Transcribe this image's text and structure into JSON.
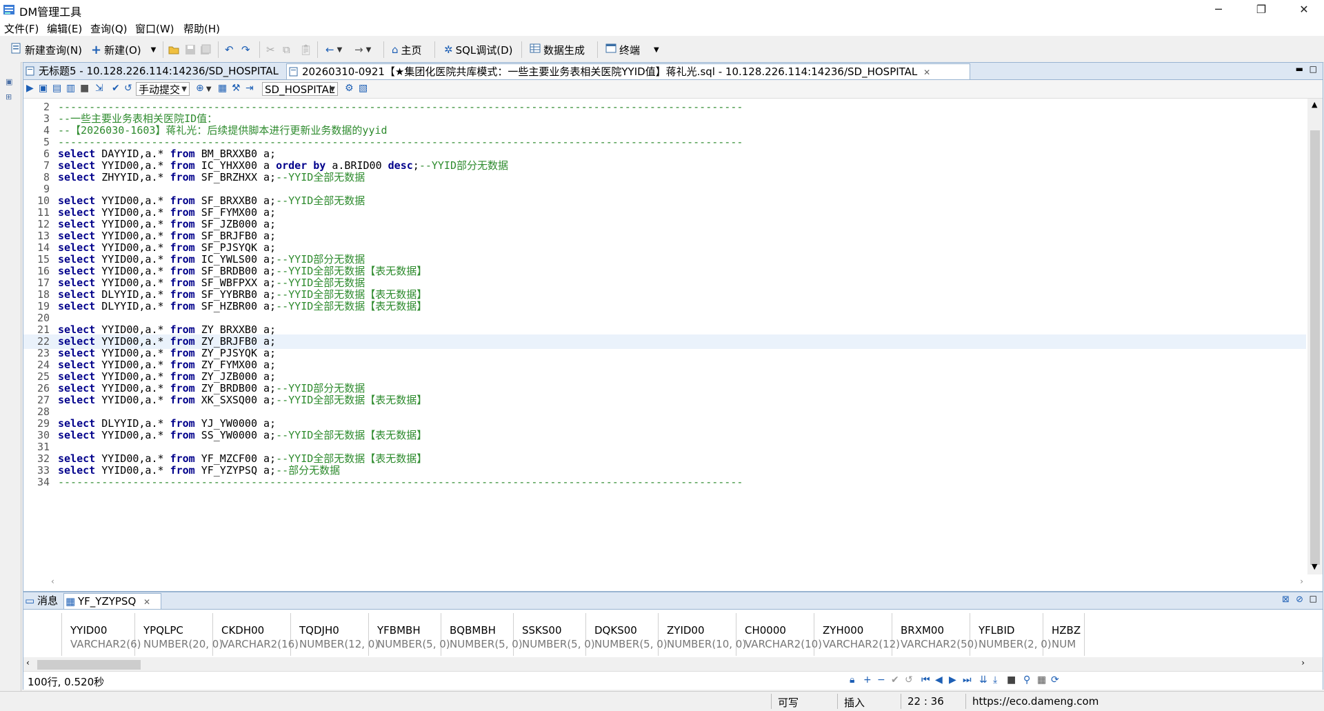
{
  "window": {
    "title": "DM管理工具",
    "minimize": "─",
    "maximize": "❐",
    "close": "✕"
  },
  "menu": [
    "文件(F)",
    "编辑(E)",
    "查询(Q)",
    "窗口(W)",
    "帮助(H)"
  ],
  "toolbar": {
    "new_query": "新建查询(N)",
    "new": "新建(O)",
    "home": "主页",
    "sql_debug": "SQL调试(D)",
    "data_gen": "数据生成",
    "terminal": "终端"
  },
  "tabs": [
    {
      "label": "无标题5 - 10.128.226.114:14236/SD_HOSPITAL"
    },
    {
      "label": "20260310-0921【★集团化医院共库模式：一些主要业务表相关医院YYID值】蒋礼光.sql - 10.128.226.114:14236/SD_HOSPITAL"
    }
  ],
  "editor_toolbar": {
    "commit_mode": "手动提交",
    "schema": "SD_HOSPITAL"
  },
  "code_lines": [
    {
      "n": "2",
      "parts": [
        [
          "cm",
          "--------------------------------------------------------------------------------------------------------------"
        ]
      ]
    },
    {
      "n": "3",
      "parts": [
        [
          "cm",
          "--一些主要业务表相关医院ID值："
        ]
      ]
    },
    {
      "n": "4",
      "parts": [
        [
          "cm",
          "--【2026030-1603】蒋礼光：后续提供脚本进行更新业务数据的yyid"
        ]
      ]
    },
    {
      "n": "5",
      "parts": [
        [
          "cm",
          "--------------------------------------------------------------------------------------------------------------"
        ]
      ]
    },
    {
      "n": "6",
      "parts": [
        [
          "kw",
          "select"
        ],
        [
          "pl",
          " DAYYID,a.* "
        ],
        [
          "kw",
          "from"
        ],
        [
          "pl",
          " BM_BRXXB0 a;"
        ]
      ]
    },
    {
      "n": "7",
      "parts": [
        [
          "kw",
          "select"
        ],
        [
          "pl",
          " YYID00,a.* "
        ],
        [
          "kw",
          "from"
        ],
        [
          "pl",
          " IC_YHXX00 a "
        ],
        [
          "kw",
          "order by"
        ],
        [
          "pl",
          " a.BRID00 "
        ],
        [
          "kw",
          "desc"
        ],
        [
          "pl",
          ";"
        ],
        [
          "cm",
          "--YYID部分无数据"
        ]
      ]
    },
    {
      "n": "8",
      "parts": [
        [
          "kw",
          "select"
        ],
        [
          "pl",
          " ZHYYID,a.* "
        ],
        [
          "kw",
          "from"
        ],
        [
          "pl",
          " SF_BRZHXX a;"
        ],
        [
          "cm",
          "--YYID全部无数据"
        ]
      ]
    },
    {
      "n": "9",
      "parts": []
    },
    {
      "n": "10",
      "parts": [
        [
          "kw",
          "select"
        ],
        [
          "pl",
          " YYID00,a.* "
        ],
        [
          "kw",
          "from"
        ],
        [
          "pl",
          " SF_BRXXB0 a;"
        ],
        [
          "cm",
          "--YYID全部无数据"
        ]
      ]
    },
    {
      "n": "11",
      "parts": [
        [
          "kw",
          "select"
        ],
        [
          "pl",
          " YYID00,a.* "
        ],
        [
          "kw",
          "from"
        ],
        [
          "pl",
          " SF_FYMX00 a;"
        ]
      ]
    },
    {
      "n": "12",
      "parts": [
        [
          "kw",
          "select"
        ],
        [
          "pl",
          " YYID00,a.* "
        ],
        [
          "kw",
          "from"
        ],
        [
          "pl",
          " SF_JZB000 a;"
        ]
      ]
    },
    {
      "n": "13",
      "parts": [
        [
          "kw",
          "select"
        ],
        [
          "pl",
          " YYID00,a.* "
        ],
        [
          "kw",
          "from"
        ],
        [
          "pl",
          " SF_BRJFB0 a;"
        ]
      ]
    },
    {
      "n": "14",
      "parts": [
        [
          "kw",
          "select"
        ],
        [
          "pl",
          " YYID00,a.* "
        ],
        [
          "kw",
          "from"
        ],
        [
          "pl",
          " SF_PJSYQK a;"
        ]
      ]
    },
    {
      "n": "15",
      "parts": [
        [
          "kw",
          "select"
        ],
        [
          "pl",
          " YYID00,a.* "
        ],
        [
          "kw",
          "from"
        ],
        [
          "pl",
          " IC_YWLS00 a;"
        ],
        [
          "cm",
          "--YYID部分无数据"
        ]
      ]
    },
    {
      "n": "16",
      "parts": [
        [
          "kw",
          "select"
        ],
        [
          "pl",
          " YYID00,a.* "
        ],
        [
          "kw",
          "from"
        ],
        [
          "pl",
          " SF_BRDB00 a;"
        ],
        [
          "cm",
          "--YYID全部无数据【表无数据】"
        ]
      ]
    },
    {
      "n": "17",
      "parts": [
        [
          "kw",
          "select"
        ],
        [
          "pl",
          " YYID00,a.* "
        ],
        [
          "kw",
          "from"
        ],
        [
          "pl",
          " SF_WBFPXX a;"
        ],
        [
          "cm",
          "--YYID全部无数据"
        ]
      ]
    },
    {
      "n": "18",
      "parts": [
        [
          "kw",
          "select"
        ],
        [
          "pl",
          " DLYYID,a.* "
        ],
        [
          "kw",
          "from"
        ],
        [
          "pl",
          " SF_YYBRB0 a;"
        ],
        [
          "cm",
          "--YYID全部无数据【表无数据】"
        ]
      ]
    },
    {
      "n": "19",
      "parts": [
        [
          "kw",
          "select"
        ],
        [
          "pl",
          " DLYYID,a.* "
        ],
        [
          "kw",
          "from"
        ],
        [
          "pl",
          " SF_HZBR00 a;"
        ],
        [
          "cm",
          "--YYID全部无数据【表无数据】"
        ]
      ]
    },
    {
      "n": "20",
      "parts": []
    },
    {
      "n": "21",
      "parts": [
        [
          "kw",
          "select"
        ],
        [
          "pl",
          " YYID00,a.* "
        ],
        [
          "kw",
          "from"
        ],
        [
          "pl",
          " ZY_BRXXB0 a;"
        ]
      ]
    },
    {
      "n": "22",
      "parts": [
        [
          "kw",
          "select"
        ],
        [
          "pl",
          " YYID00,a.* "
        ],
        [
          "kw",
          "from"
        ],
        [
          "pl",
          " ZY_BRJFB0 a;"
        ]
      ],
      "hl": true
    },
    {
      "n": "23",
      "parts": [
        [
          "kw",
          "select"
        ],
        [
          "pl",
          " YYID00,a.* "
        ],
        [
          "kw",
          "from"
        ],
        [
          "pl",
          " ZY_PJSYQK a;"
        ]
      ]
    },
    {
      "n": "24",
      "parts": [
        [
          "kw",
          "select"
        ],
        [
          "pl",
          " YYID00,a.* "
        ],
        [
          "kw",
          "from"
        ],
        [
          "pl",
          " ZY_FYMX00 a;"
        ]
      ]
    },
    {
      "n": "25",
      "parts": [
        [
          "kw",
          "select"
        ],
        [
          "pl",
          " YYID00,a.* "
        ],
        [
          "kw",
          "from"
        ],
        [
          "pl",
          " ZY_JZB000 a;"
        ]
      ]
    },
    {
      "n": "26",
      "parts": [
        [
          "kw",
          "select"
        ],
        [
          "pl",
          " YYID00,a.* "
        ],
        [
          "kw",
          "from"
        ],
        [
          "pl",
          " ZY_BRDB00 a;"
        ],
        [
          "cm",
          "--YYID部分无数据"
        ]
      ]
    },
    {
      "n": "27",
      "parts": [
        [
          "kw",
          "select"
        ],
        [
          "pl",
          " YYID00,a.* "
        ],
        [
          "kw",
          "from"
        ],
        [
          "pl",
          " XK_SXSQ00 a;"
        ],
        [
          "cm",
          "--YYID全部无数据【表无数据】"
        ]
      ]
    },
    {
      "n": "28",
      "parts": []
    },
    {
      "n": "29",
      "parts": [
        [
          "kw",
          "select"
        ],
        [
          "pl",
          " DLYYID,a.* "
        ],
        [
          "kw",
          "from"
        ],
        [
          "pl",
          " YJ_YW0000 a;"
        ]
      ]
    },
    {
      "n": "30",
      "parts": [
        [
          "kw",
          "select"
        ],
        [
          "pl",
          " YYID00,a.* "
        ],
        [
          "kw",
          "from"
        ],
        [
          "pl",
          " SS_YW0000 a;"
        ],
        [
          "cm",
          "--YYID全部无数据【表无数据】"
        ]
      ]
    },
    {
      "n": "31",
      "parts": []
    },
    {
      "n": "32",
      "parts": [
        [
          "kw",
          "select"
        ],
        [
          "pl",
          " YYID00,a.* "
        ],
        [
          "kw",
          "from"
        ],
        [
          "pl",
          " YF_MZCF00 a;"
        ],
        [
          "cm",
          "--YYID全部无数据【表无数据】"
        ]
      ]
    },
    {
      "n": "33",
      "parts": [
        [
          "kw",
          "select"
        ],
        [
          "pl",
          " YYID00,a.* "
        ],
        [
          "kw",
          "from"
        ],
        [
          "pl",
          " YF_YZYPSQ a;"
        ],
        [
          "cm",
          "--部分无数据"
        ]
      ]
    },
    {
      "n": "34",
      "parts": [
        [
          "cm",
          "--------------------------------------------------------------------------------------------------------------"
        ]
      ]
    }
  ],
  "result_tabs": {
    "messages": "消息",
    "table": "YF_YZYPSQ"
  },
  "columns": [
    {
      "name": "YYID00",
      "type": "VARCHAR2(6)"
    },
    {
      "name": "YPQLPC",
      "type": "NUMBER(20, 0)"
    },
    {
      "name": "CKDH00",
      "type": "VARCHAR2(16)"
    },
    {
      "name": "TQDJH0",
      "type": "NUMBER(12, 0)"
    },
    {
      "name": "YFBMBH",
      "type": "NUMBER(5, 0)"
    },
    {
      "name": "BQBMBH",
      "type": "NUMBER(5, 0)"
    },
    {
      "name": "SSKS00",
      "type": "NUMBER(5, 0)"
    },
    {
      "name": "DQKS00",
      "type": "NUMBER(5, 0)"
    },
    {
      "name": "ZYID00",
      "type": "NUMBER(10, 0)"
    },
    {
      "name": "CH0000",
      "type": "VARCHAR2(10)"
    },
    {
      "name": "ZYH000",
      "type": "VARCHAR2(12)"
    },
    {
      "name": "BRXM00",
      "type": "VARCHAR2(50)"
    },
    {
      "name": "YFLBID",
      "type": "NUMBER(2, 0)"
    },
    {
      "name": "HZBZ",
      "type": "NUM"
    }
  ],
  "result_status": "100行, 0.520秒",
  "status": {
    "writable": "可写",
    "insert": "插入",
    "position": "22 : 36",
    "url": "https://eco.dameng.com"
  },
  "colors": {
    "keyword": "#00008b",
    "comment": "#2e8b2e",
    "tab_bg": "#dde7f3",
    "border": "#99b4d1"
  }
}
